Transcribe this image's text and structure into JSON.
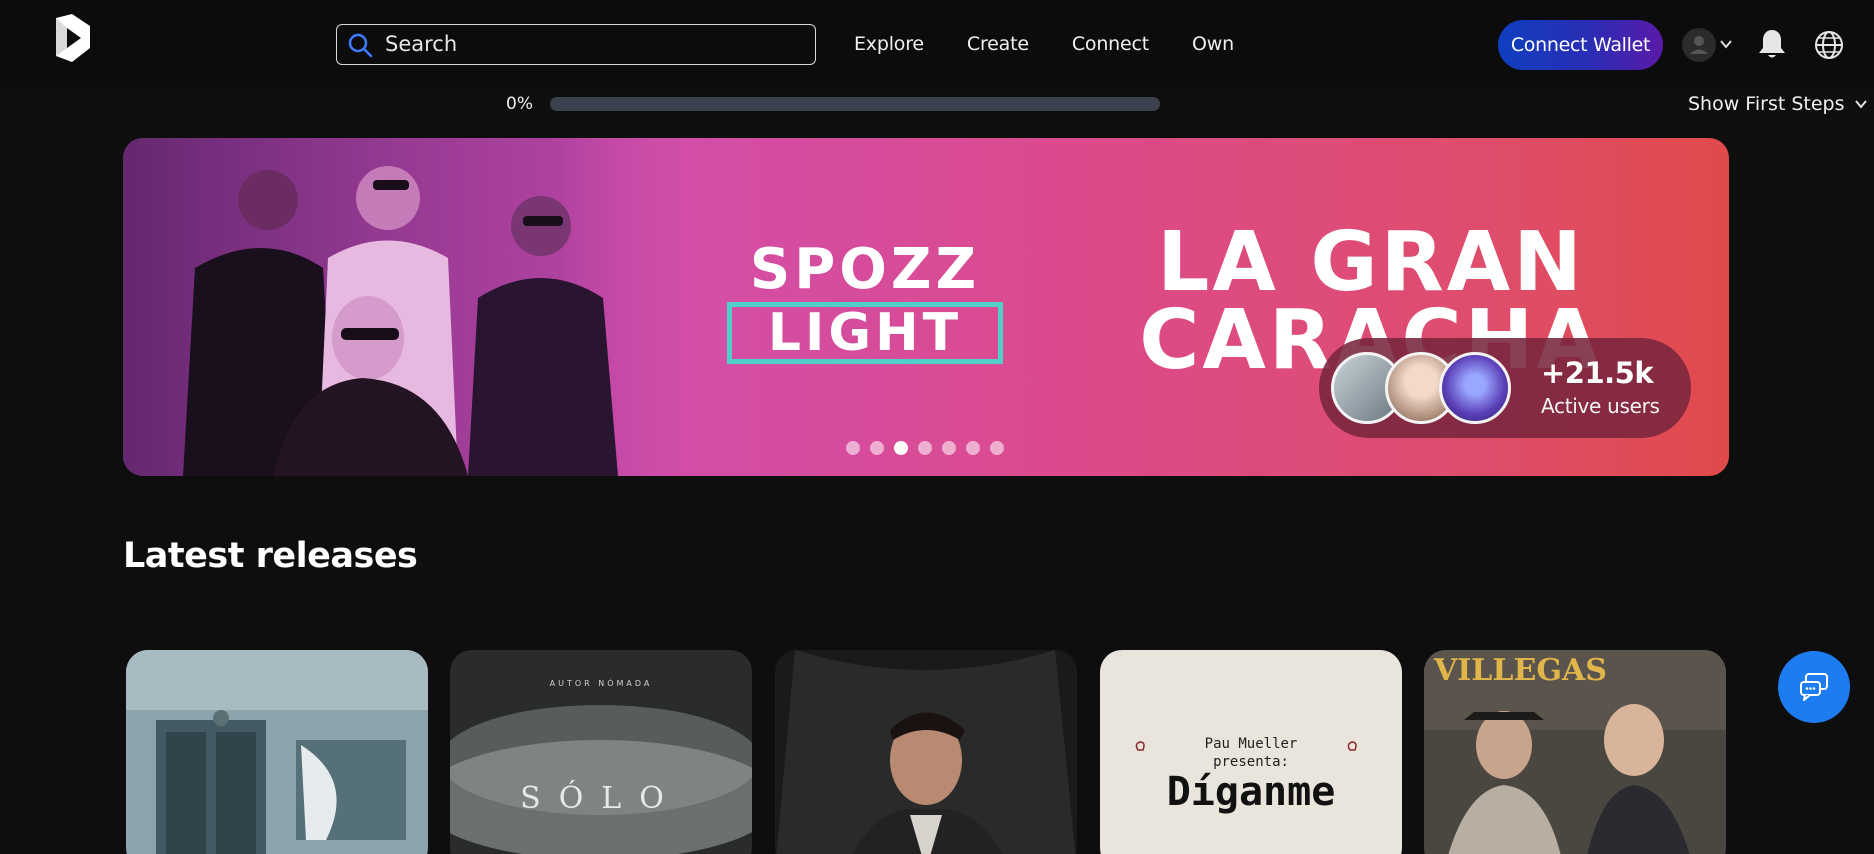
{
  "header": {
    "logo_icon": "play-logo-icon",
    "search": {
      "placeholder": "Search",
      "value": ""
    },
    "nav": [
      "Explore",
      "Create",
      "Connect",
      "Own"
    ],
    "connect_wallet": "Connect Wallet",
    "icons": [
      "user-avatar-icon",
      "chevron-down-icon",
      "bell-icon",
      "globe-icon"
    ]
  },
  "progress": {
    "label": "0%",
    "value": 0
  },
  "first_steps": {
    "label": "Show First Steps"
  },
  "banner": {
    "brand_top": "SPOZZ",
    "brand_bottom": "LIGHT",
    "headline_line1": "LA GRAN",
    "headline_line2": "CARACHA",
    "users_count": "+21.5k",
    "users_label": "Active users",
    "slides": 7,
    "active_slide": 3,
    "colors": {
      "gradient_start": "#b246c3",
      "gradient_end": "#e14a4a",
      "box_border": "#4fcfc8"
    }
  },
  "latest": {
    "title": "Latest releases",
    "cards": [
      {
        "name": "release-card-1",
        "text": ""
      },
      {
        "name": "release-card-2",
        "text": "AUTOR NÓMADA",
        "subtitle": "SÓLO"
      },
      {
        "name": "release-card-3",
        "text": ""
      },
      {
        "name": "release-card-4",
        "text": "Pau Mueller",
        "subtitle": "presenta:",
        "title": "Díganme"
      },
      {
        "name": "release-card-5",
        "text": "VILLEGAS"
      }
    ]
  },
  "chat": {
    "icon": "chat-bubbles-icon"
  },
  "colors": {
    "accent": "#1e7cf2",
    "background": "#0e0e0e"
  }
}
